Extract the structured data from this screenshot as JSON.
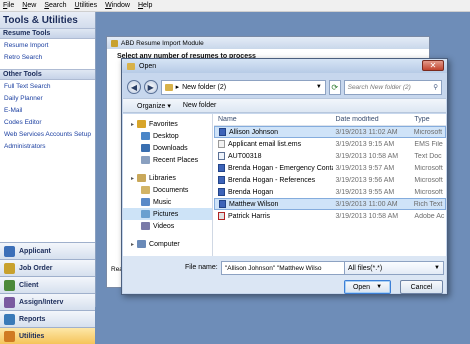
{
  "menu": [
    "File",
    "New",
    "Search",
    "Utilities",
    "Window",
    "Help"
  ],
  "sidebar": {
    "title": "Tools & Utilities",
    "sections": [
      {
        "heading": "Resume Tools",
        "links": [
          "Resume Import",
          "Retro Search"
        ]
      },
      {
        "heading": "Other Tools",
        "links": [
          "Full Text Search",
          "Daily Planner",
          "E-Mail",
          "Codes Editor",
          "Web Services Accounts Setup",
          "Administrators"
        ]
      }
    ],
    "nav": [
      {
        "label": "Applicant",
        "color": "#3c6fb8"
      },
      {
        "label": "Job Order",
        "color": "#c8a12e"
      },
      {
        "label": "Client",
        "color": "#4c8a3a"
      },
      {
        "label": "Assign/Interv",
        "color": "#7a5aa0"
      },
      {
        "label": "Reports",
        "color": "#3a7ab8"
      },
      {
        "label": "Utilities",
        "color": "#d07a22"
      }
    ]
  },
  "module_window": {
    "title": "ABD Resume Import Module",
    "select_text": "Select any number of resumes to process",
    "footer_text": "Rea"
  },
  "dialog": {
    "title": "Open",
    "address": "New folder (2)",
    "search_placeholder": "Search New folder (2)",
    "organize": "Organize",
    "new_folder": "New folder",
    "tree": [
      {
        "label": "Favorites",
        "level": 0,
        "color": "#d8a52a"
      },
      {
        "label": "Desktop",
        "level": 1,
        "color": "#4a86c8"
      },
      {
        "label": "Downloads",
        "level": 1,
        "color": "#3a6fb0"
      },
      {
        "label": "Recent Places",
        "level": 1,
        "color": "#8aa0c0"
      },
      {
        "label": "Libraries",
        "level": 0,
        "color": "#c9a85a"
      },
      {
        "label": "Documents",
        "level": 1,
        "color": "#d2b466"
      },
      {
        "label": "Music",
        "level": 1,
        "color": "#5a8ac8"
      },
      {
        "label": "Pictures",
        "level": 1,
        "color": "#6aa0d0",
        "selected": true
      },
      {
        "label": "Videos",
        "level": 1,
        "color": "#7a7aa8"
      },
      {
        "label": "Computer",
        "level": 0,
        "color": "#6a8ab8"
      }
    ],
    "columns": {
      "name": "Name",
      "date": "Date modified",
      "type": "Type"
    },
    "files": [
      {
        "name": "Allison Johnson",
        "date": "3/19/2013 11:02 AM",
        "type": "Microsoft",
        "icon": "word",
        "selected": true
      },
      {
        "name": "Applicant email list.ems",
        "date": "3/19/2013 9:15 AM",
        "type": "EMS File",
        "icon": "ems"
      },
      {
        "name": "AUT00318",
        "date": "3/19/2013 10:58 AM",
        "type": "Text Doc",
        "icon": "txt"
      },
      {
        "name": "Brenda Hogan - Emergency Contacts",
        "date": "3/19/2013 9:57 AM",
        "type": "Microsoft",
        "icon": "word"
      },
      {
        "name": "Brenda Hogan - References",
        "date": "3/19/2013 9:56 AM",
        "type": "Microsoft",
        "icon": "word"
      },
      {
        "name": "Brenda Hogan",
        "date": "3/19/2013 9:55 AM",
        "type": "Microsoft",
        "icon": "word"
      },
      {
        "name": "Matthew Wilson",
        "date": "3/19/2013 11:00 AM",
        "type": "Rich Text",
        "icon": "word",
        "selected": true
      },
      {
        "name": "Patrick Harris",
        "date": "3/19/2013 10:58 AM",
        "type": "Adobe Ac",
        "icon": "pdf"
      }
    ],
    "file_name_label": "File name:",
    "file_name_value": "\"Allison Johnson\" \"Matthew Wilso",
    "file_type": "All files(*.*)",
    "open_label": "Open",
    "cancel_label": "Cancel"
  }
}
